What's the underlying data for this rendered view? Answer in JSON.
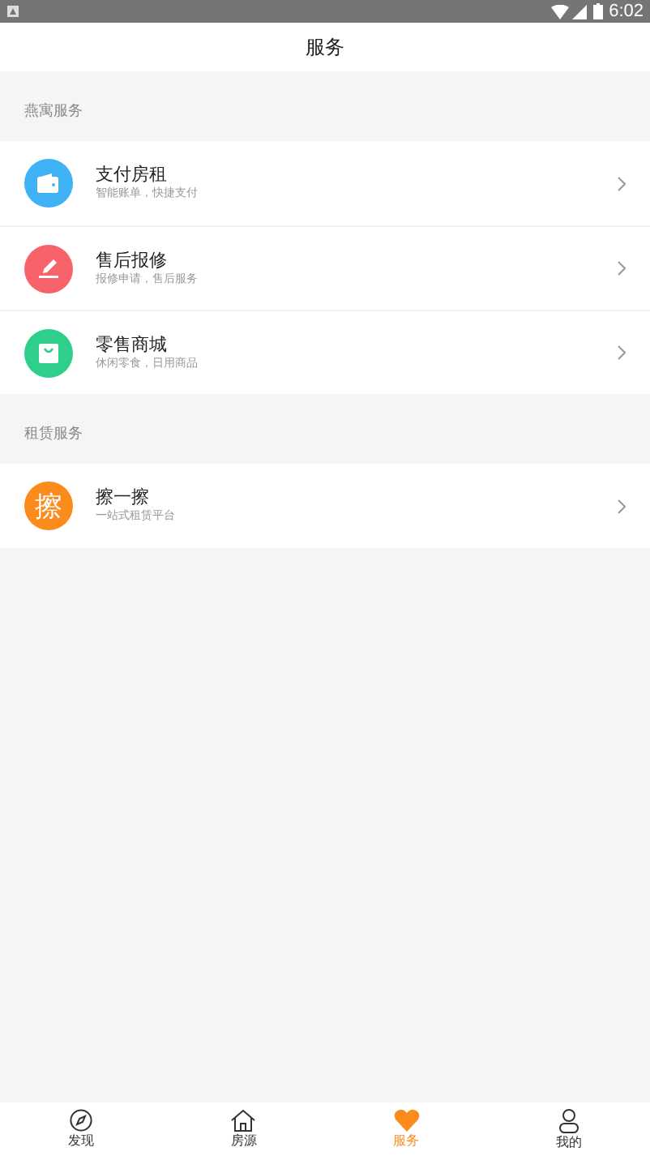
{
  "status_bar": {
    "time": "6:02"
  },
  "header": {
    "title": "服务"
  },
  "sections": [
    {
      "title": "燕寓服务",
      "items": [
        {
          "kind": "wallet",
          "title": "支付房租",
          "subtitle": "智能账单，快捷支付",
          "color": "#3fb2f5"
        },
        {
          "kind": "repair",
          "title": "售后报修",
          "subtitle": "报修申请，售后服务",
          "color": "#f8636a"
        },
        {
          "kind": "bag",
          "title": "零售商城",
          "subtitle": "休闲零食，日用商品",
          "color": "#2ecf8a"
        }
      ]
    },
    {
      "title": "租赁服务",
      "items": [
        {
          "kind": "char",
          "icon_text": "擦",
          "title": "擦一擦",
          "subtitle": "一站式租赁平台",
          "color": "#fb8c1c"
        }
      ]
    }
  ],
  "tabs": [
    {
      "kind": "compass",
      "label": "发现",
      "selected": false
    },
    {
      "kind": "house",
      "label": "房源",
      "selected": false
    },
    {
      "kind": "heart",
      "label": "服务",
      "selected": true
    },
    {
      "kind": "person",
      "label": "我的",
      "selected": false
    }
  ]
}
